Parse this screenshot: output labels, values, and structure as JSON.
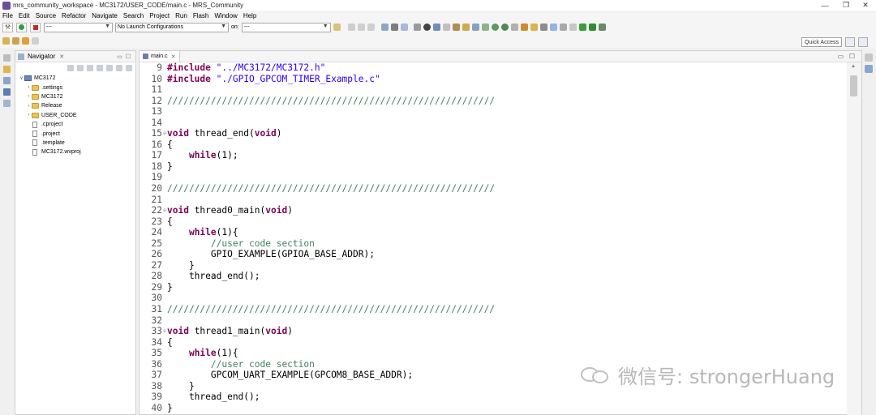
{
  "window": {
    "title": "mrs_community_workspace - MC3172/USER_CODE/main.c - MRS_Community",
    "minimize": "—",
    "restore": "❐",
    "close": "✕"
  },
  "menu": [
    "File",
    "Edit",
    "Source",
    "Refactor",
    "Navigate",
    "Search",
    "Project",
    "Run",
    "Flash",
    "Window",
    "Help"
  ],
  "toolbar": {
    "combo1": "---",
    "launch_config": "No Launch Configurations",
    "on_label": "on:",
    "combo3": "---",
    "quick_access": "Quick Access"
  },
  "navigator": {
    "tab_label": "Navigator",
    "close": "✕",
    "tree": [
      {
        "label": "MC3172",
        "level": 0,
        "kind": "project",
        "expanded": true
      },
      {
        "label": ".settings",
        "level": 1,
        "kind": "folder"
      },
      {
        "label": "MC3172",
        "level": 1,
        "kind": "folder"
      },
      {
        "label": "Release",
        "level": 1,
        "kind": "folder"
      },
      {
        "label": "USER_CODE",
        "level": 1,
        "kind": "folder"
      },
      {
        "label": ".cproject",
        "level": 1,
        "kind": "file"
      },
      {
        "label": ".project",
        "level": 1,
        "kind": "file"
      },
      {
        "label": ".template",
        "level": 1,
        "kind": "file"
      },
      {
        "label": "MC3172.wvproj",
        "level": 1,
        "kind": "file"
      }
    ]
  },
  "editor": {
    "tab_label": "main.c",
    "close": "✕",
    "lines": [
      {
        "n": "9",
        "fold": "",
        "code": "#include \"../MC3172/MC3172.h\""
      },
      {
        "n": "10",
        "fold": "",
        "code": "#include \"./GPIO_GPCOM_TIMER_Example.c\""
      },
      {
        "n": "11",
        "fold": "",
        "code": ""
      },
      {
        "n": "12",
        "fold": "",
        "code": "////////////////////////////////////////////////////////////"
      },
      {
        "n": "13",
        "fold": "",
        "code": ""
      },
      {
        "n": "14",
        "fold": "",
        "code": ""
      },
      {
        "n": "15",
        "fold": "⊖",
        "code": "void thread_end(void)"
      },
      {
        "n": "16",
        "fold": "",
        "code": "{"
      },
      {
        "n": "17",
        "fold": "",
        "code": "    while(1);"
      },
      {
        "n": "18",
        "fold": "",
        "code": "}"
      },
      {
        "n": "19",
        "fold": "",
        "code": ""
      },
      {
        "n": "20",
        "fold": "",
        "code": "////////////////////////////////////////////////////////////"
      },
      {
        "n": "21",
        "fold": "",
        "code": ""
      },
      {
        "n": "22",
        "fold": "⊖",
        "code": "void thread0_main(void)"
      },
      {
        "n": "23",
        "fold": "",
        "code": "{"
      },
      {
        "n": "24",
        "fold": "",
        "code": "    while(1){"
      },
      {
        "n": "25",
        "fold": "",
        "code": "        //user code section"
      },
      {
        "n": "26",
        "fold": "",
        "code": "        GPIO_EXAMPLE(GPIOA_BASE_ADDR);"
      },
      {
        "n": "27",
        "fold": "",
        "code": "    }"
      },
      {
        "n": "28",
        "fold": "",
        "code": "    thread_end();"
      },
      {
        "n": "29",
        "fold": "",
        "code": "}"
      },
      {
        "n": "30",
        "fold": "",
        "code": ""
      },
      {
        "n": "31",
        "fold": "",
        "code": "////////////////////////////////////////////////////////////"
      },
      {
        "n": "32",
        "fold": "",
        "code": ""
      },
      {
        "n": "33",
        "fold": "⊖",
        "code": "void thread1_main(void)"
      },
      {
        "n": "34",
        "fold": "",
        "code": "{"
      },
      {
        "n": "35",
        "fold": "",
        "code": "    while(1){"
      },
      {
        "n": "36",
        "fold": "",
        "code": "        //user code section"
      },
      {
        "n": "37",
        "fold": "",
        "code": "        GPCOM_UART_EXAMPLE(GPCOM8_BASE_ADDR);"
      },
      {
        "n": "38",
        "fold": "",
        "code": "    }"
      },
      {
        "n": "39",
        "fold": "",
        "code": "    thread_end();"
      },
      {
        "n": "40",
        "fold": "",
        "code": "}"
      }
    ]
  },
  "watermark": {
    "text": "微信号: strongerHuang"
  },
  "colors": {
    "keyword": "#7f0055",
    "string": "#2a00ff",
    "comment": "#3f7f5f",
    "run_green": "#2e9e3a",
    "stop_red": "#c62828"
  }
}
